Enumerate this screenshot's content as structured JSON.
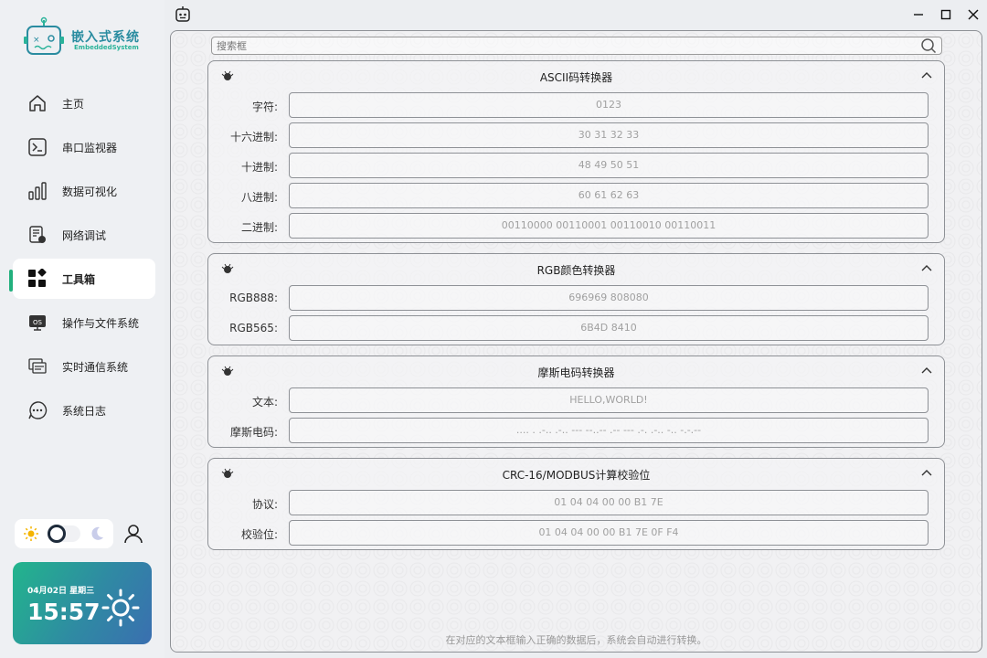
{
  "brand": {
    "title": "嵌入式系统",
    "subtitle": "EmbeddedSystem"
  },
  "nav": [
    {
      "id": "home",
      "label": "主页",
      "icon": "home-icon"
    },
    {
      "id": "serial",
      "label": "串口监视器",
      "icon": "terminal-icon"
    },
    {
      "id": "visual",
      "label": "数据可视化",
      "icon": "bar-chart-icon"
    },
    {
      "id": "network",
      "label": "网络调试",
      "icon": "network-doc-icon"
    },
    {
      "id": "toolbox",
      "label": "工具箱",
      "icon": "widgets-icon",
      "active": true
    },
    {
      "id": "os",
      "label": "操作与文件系统",
      "icon": "os-monitor-icon"
    },
    {
      "id": "rtos",
      "label": "实时通信系统",
      "icon": "windows-stack-icon"
    },
    {
      "id": "log",
      "label": "系统日志",
      "icon": "chat-bubble-icon"
    }
  ],
  "weather": {
    "date": "04月02日  星期三",
    "time": "15:57",
    "icon": "sun-icon"
  },
  "search": {
    "placeholder": "搜索框"
  },
  "cards": {
    "ascii": {
      "title": "ASCII码转换器",
      "rows": [
        {
          "label": "字符:",
          "value": "0123"
        },
        {
          "label": "十六进制:",
          "value": "30 31 32 33"
        },
        {
          "label": "十进制:",
          "value": "48 49 50 51"
        },
        {
          "label": "八进制:",
          "value": "60 61 62 63"
        },
        {
          "label": "二进制:",
          "value": "00110000 00110001 00110010 00110011"
        }
      ]
    },
    "rgb": {
      "title": "RGB颜色转换器",
      "rows": [
        {
          "label": "RGB888:",
          "value": "696969 808080"
        },
        {
          "label": "RGB565:",
          "value": "6B4D 8410"
        }
      ]
    },
    "morse": {
      "title": "摩斯电码转换器",
      "rows": [
        {
          "label": "文本:",
          "value": "HELLO,WORLD!"
        },
        {
          "label": "摩斯电码:",
          "value": ".... . .-.. .-.. --- --..-- .-- --- .-. .-.. -.. -.-.--"
        }
      ]
    },
    "crc": {
      "title": "CRC-16/MODBUS计算校验位",
      "rows": [
        {
          "label": "协议:",
          "value": "01 04 04 00 00 B1 7E"
        },
        {
          "label": "校验位:",
          "value": "01 04 04 00 00 B1 7E 0F F4"
        }
      ]
    }
  },
  "footer": "在对应的文本框输入正确的数据后，系统会自动进行转换。",
  "colors": {
    "accent": "#22b07d",
    "brand": "#2a8ca0",
    "border": "#8e9196"
  }
}
